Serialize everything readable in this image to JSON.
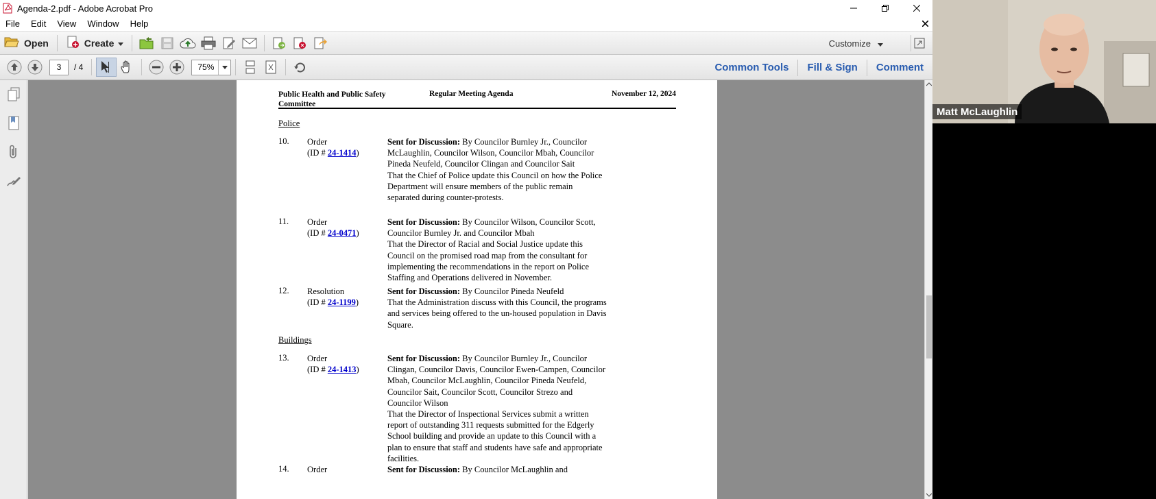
{
  "window": {
    "title": "Agenda-2.pdf - Adobe Acrobat Pro"
  },
  "menu": [
    "File",
    "Edit",
    "View",
    "Window",
    "Help"
  ],
  "toolbar": {
    "open_label": "Open",
    "create_label": "Create",
    "customize_label": "Customize"
  },
  "nav": {
    "current_page": "3",
    "total_pages": "/ 4",
    "zoom": "75%"
  },
  "right_tabs": [
    "Common Tools",
    "Fill & Sign",
    "Comment"
  ],
  "document": {
    "header": {
      "committee": "Public Health and Public Safety Committee",
      "meeting": "Regular Meeting Agenda",
      "date": "November 12, 2024"
    },
    "sections": [
      {
        "title": "Police",
        "items": [
          {
            "num": "10.",
            "type": "Order",
            "id_prefix": "(ID # ",
            "id": "24-1414",
            "id_suffix": ")",
            "lead": "Sent for Discussion:",
            "sponsors": " By Councilor Burnley Jr., Councilor McLaughlin, Councilor Wilson, Councilor Mbah, Councilor Pineda Neufeld, Councilor Clingan and Councilor Sait",
            "text": "That the Chief of Police update this Council on how the Police Department will ensure members of the public remain separated during counter-protests."
          },
          {
            "num": "11.",
            "type": "Order",
            "id_prefix": "(ID # ",
            "id": "24-0471",
            "id_suffix": ")",
            "lead": "Sent for Discussion:",
            "sponsors": " By Councilor Wilson, Councilor Scott, Councilor Burnley Jr. and Councilor Mbah",
            "text": "That the Director of Racial and Social Justice update this Council on the promised road map from the consultant for implementing the recommendations in the report on Police Staffing and Operations delivered in November."
          },
          {
            "num": "12.",
            "type": "Resolution",
            "id_prefix": "(ID # ",
            "id": "24-1199",
            "id_suffix": ")",
            "lead": "Sent for Discussion:",
            "sponsors": " By Councilor Pineda Neufeld",
            "text": "That the Administration discuss with this Council, the programs and services being offered to the un-housed population in Davis Square."
          }
        ]
      },
      {
        "title": "Buildings",
        "items": [
          {
            "num": "13.",
            "type": "Order",
            "id_prefix": "(ID # ",
            "id": "24-1413",
            "id_suffix": ")",
            "lead": "Sent for Discussion:",
            "sponsors": " By Councilor Burnley Jr., Councilor Clingan, Councilor Davis, Councilor Ewen-Campen, Councilor Mbah, Councilor McLaughlin, Councilor Pineda Neufeld, Councilor Sait, Councilor Scott, Councilor Strezo and Councilor Wilson",
            "text": "That the Director of Inspectional Services submit a written report of outstanding 311 requests submitted for the Edgerly School building and provide an update to this Council with a plan to ensure that staff and students have safe and appropriate facilities."
          },
          {
            "num": "14.",
            "type": "Order",
            "id_prefix": "",
            "id": "",
            "id_suffix": "",
            "lead": "Sent for Discussion:",
            "sponsors": " By Councilor McLaughlin and",
            "text": ""
          }
        ]
      }
    ]
  },
  "video": {
    "participant_name": "Matt McLaughlin"
  },
  "colors": {
    "link": "#0000cc",
    "tab_blue": "#2a5db0",
    "doc_bg": "#8c8c8c",
    "acrobat_red": "#c8102e"
  }
}
